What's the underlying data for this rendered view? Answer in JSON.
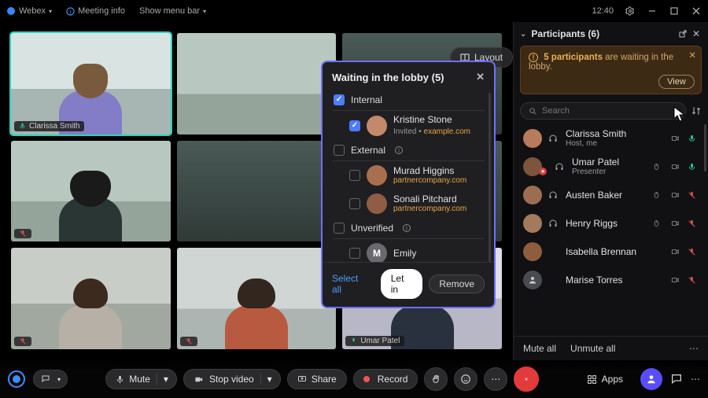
{
  "titlebar": {
    "app": "Webex",
    "meetingInfo": "Meeting info",
    "menuBar": "Show menu bar",
    "clock": "12:40"
  },
  "layoutControl": {
    "label": "Layout"
  },
  "tiles": [
    {
      "name": "Clarissa Smith",
      "muted": false,
      "active": true
    },
    {
      "name": "",
      "muted": true,
      "active": false
    },
    {
      "name": "",
      "muted": false,
      "active": false
    },
    {
      "name": "",
      "muted": true,
      "active": false
    },
    {
      "name": "",
      "muted": true,
      "active": false
    },
    {
      "name": "Umar Patel",
      "muted": false,
      "active": false
    }
  ],
  "lobby": {
    "title": "Waiting in the lobby (5)",
    "selectAll": "Select all",
    "letIn": "Let in",
    "remove": "Remove",
    "sections": {
      "internal": {
        "label": "Internal",
        "checked": true
      },
      "external": {
        "label": "External",
        "checked": false
      },
      "unverified": {
        "label": "Unverified",
        "checked": false
      }
    },
    "internal": [
      {
        "name": "Kristine Stone",
        "meta1": "Invited",
        "meta2": "example.com",
        "checked": true,
        "avatarColor": "#c28a6b"
      }
    ],
    "external": [
      {
        "name": "Murad Higgins",
        "meta": "partnercompany.com",
        "checked": false,
        "avatarColor": "#a86f4e"
      },
      {
        "name": "Sonali Pitchard",
        "meta": "partnercompany.com",
        "checked": false,
        "avatarColor": "#8f5c44"
      }
    ],
    "unverified": [
      {
        "name": "Emily",
        "initial": "M",
        "checked": false
      }
    ]
  },
  "participants": {
    "title": "Participants (6)",
    "alertHighlight": "5 participants",
    "alertRest": " are waiting in the lobby.",
    "viewLabel": "View",
    "searchPlaceholder": "Search",
    "muteAll": "Mute all",
    "unmuteAll": "Unmute all",
    "list": [
      {
        "name": "Clarissa Smith",
        "role": "Host, me",
        "headset": true,
        "mouse": false,
        "cam": true,
        "mic": "on",
        "avatarColor": "#b87b5b"
      },
      {
        "name": "Umar Patel",
        "role": "Presenter",
        "headset": true,
        "mouse": true,
        "cam": true,
        "mic": "on",
        "avatarColor": "#7d553c",
        "presenter": true
      },
      {
        "name": "Austen Baker",
        "role": "",
        "headset": true,
        "mouse": true,
        "cam": true,
        "mic": "off",
        "avatarColor": "#9b6d53"
      },
      {
        "name": "Henry Riggs",
        "role": "",
        "headset": true,
        "mouse": true,
        "cam": true,
        "mic": "off",
        "avatarColor": "#a37a5c"
      },
      {
        "name": "Isabella Brennan",
        "role": "",
        "headset": false,
        "mouse": false,
        "cam": true,
        "mic": "off",
        "avatarColor": "#8e5c3f"
      },
      {
        "name": "Marise Torres",
        "role": "",
        "headset": false,
        "mouse": false,
        "cam": true,
        "mic": "off",
        "avatarColor": "#4a4a52",
        "initials": true
      }
    ]
  },
  "controls": {
    "mute": "Mute",
    "stopVideo": "Stop video",
    "share": "Share",
    "record": "Record",
    "apps": "Apps"
  }
}
